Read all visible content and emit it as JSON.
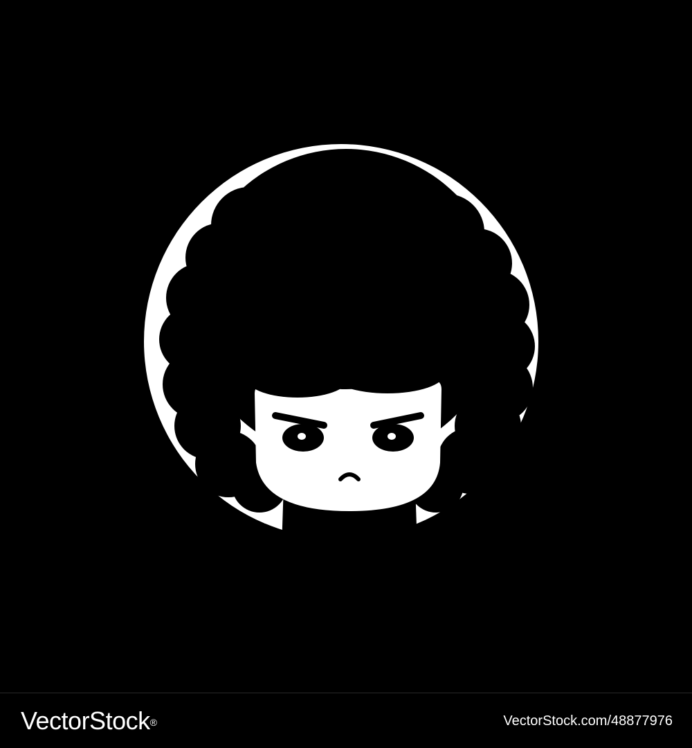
{
  "footer": {
    "brand_text": "VectorStock",
    "registered_mark": "®",
    "image_id": "VectorStock.com/48877976"
  },
  "artwork": {
    "subject": "girl-with-afro-emblem",
    "colors": {
      "background": "#000000",
      "foreground": "#ffffff"
    }
  }
}
